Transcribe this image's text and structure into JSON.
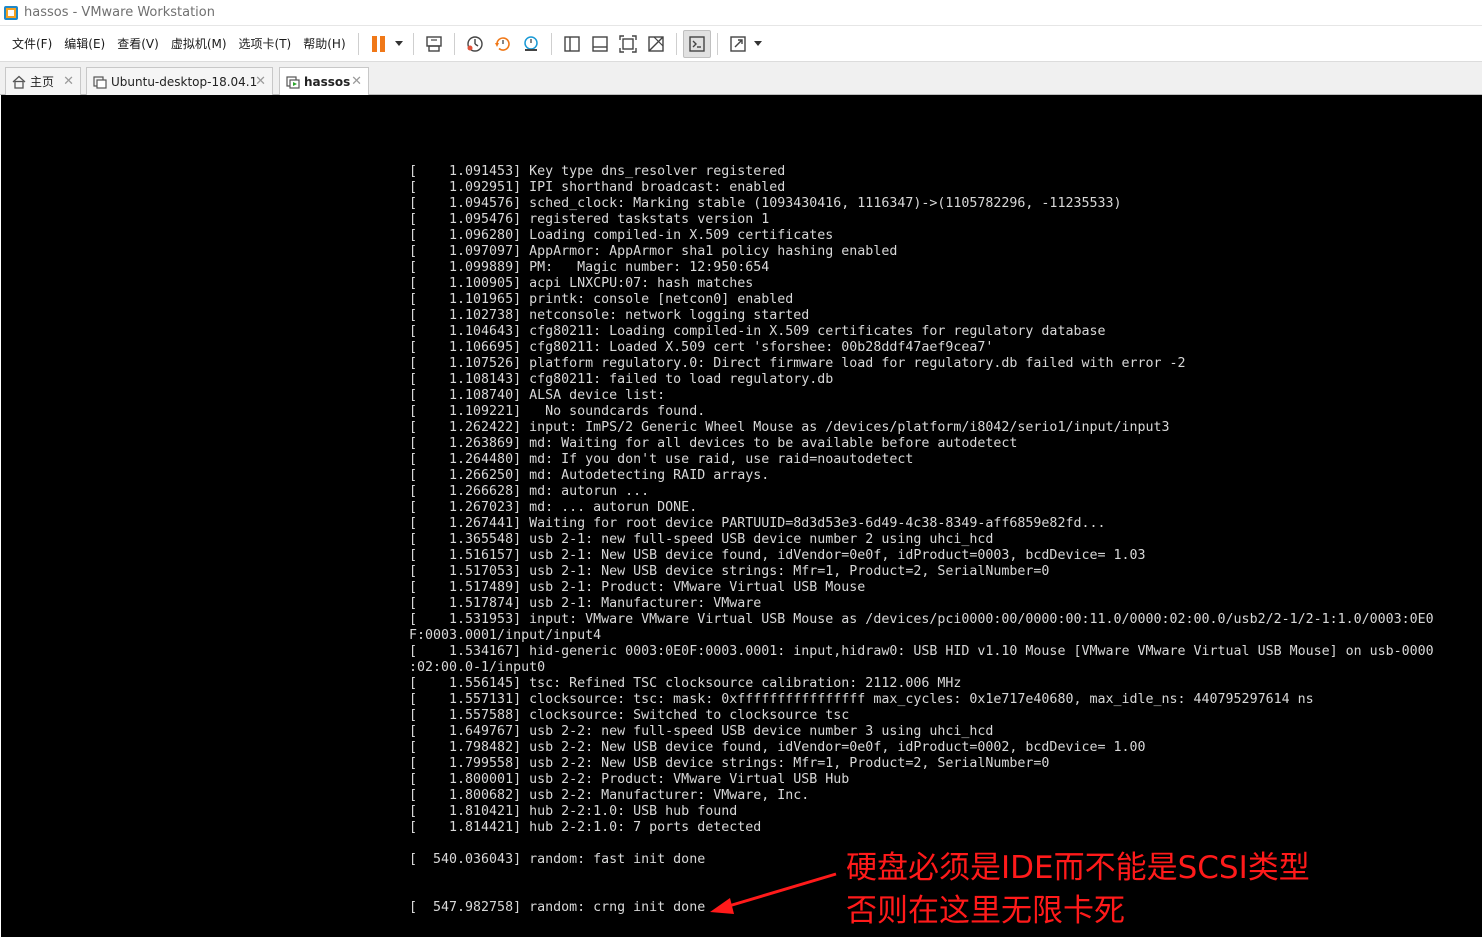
{
  "window": {
    "title": "hassos - VMware Workstation"
  },
  "menu": [
    "文件(F)",
    "编辑(E)",
    "查看(V)",
    "虚拟机(M)",
    "选项卡(T)",
    "帮助(H)"
  ],
  "toolbar": {
    "icons": [
      "pause-icon",
      "send-ctrl-alt-del-icon",
      "snapshot-icon",
      "revert-snapshot-icon",
      "snapshot-manager-icon",
      "library-view-icon",
      "thumbnail-view-icon",
      "fit-guest-icon",
      "unity-icon",
      "console-view-icon",
      "fullscreen-icon"
    ],
    "accent": "#f07818"
  },
  "tabs": [
    {
      "label": "主页",
      "icon": "home-icon",
      "selected": false
    },
    {
      "label": "Ubuntu-desktop-18.04.1",
      "icon": "vm-icon",
      "selected": false
    },
    {
      "label": "hassos",
      "icon": "vm-running-icon",
      "selected": true
    }
  ],
  "console": {
    "lines": [
      "[    1.091453] Key type dns_resolver registered",
      "[    1.092951] IPI shorthand broadcast: enabled",
      "[    1.094576] sched_clock: Marking stable (1093430416, 1116347)->(1105782296, -11235533)",
      "[    1.095476] registered taskstats version 1",
      "[    1.096280] Loading compiled-in X.509 certificates",
      "[    1.097097] AppArmor: AppArmor sha1 policy hashing enabled",
      "[    1.099889] PM:   Magic number: 12:950:654",
      "[    1.100905] acpi LNXCPU:07: hash matches",
      "[    1.101965] printk: console [netcon0] enabled",
      "[    1.102738] netconsole: network logging started",
      "[    1.104643] cfg80211: Loading compiled-in X.509 certificates for regulatory database",
      "[    1.106695] cfg80211: Loaded X.509 cert 'sforshee: 00b28ddf47aef9cea7'",
      "[    1.107526] platform regulatory.0: Direct firmware load for regulatory.db failed with error -2",
      "[    1.108143] cfg80211: failed to load regulatory.db",
      "[    1.108740] ALSA device list:",
      "[    1.109221]   No soundcards found.",
      "[    1.262422] input: ImPS/2 Generic Wheel Mouse as /devices/platform/i8042/serio1/input/input3",
      "[    1.263869] md: Waiting for all devices to be available before autodetect",
      "[    1.264480] md: If you don't use raid, use raid=noautodetect",
      "[    1.266250] md: Autodetecting RAID arrays.",
      "[    1.266628] md: autorun ...",
      "[    1.267023] md: ... autorun DONE.",
      "[    1.267441] Waiting for root device PARTUUID=8d3d53e3-6d49-4c38-8349-aff6859e82fd...",
      "[    1.365548] usb 2-1: new full-speed USB device number 2 using uhci_hcd",
      "[    1.516157] usb 2-1: New USB device found, idVendor=0e0f, idProduct=0003, bcdDevice= 1.03",
      "[    1.517053] usb 2-1: New USB device strings: Mfr=1, Product=2, SerialNumber=0",
      "[    1.517489] usb 2-1: Product: VMware Virtual USB Mouse",
      "[    1.517874] usb 2-1: Manufacturer: VMware",
      "[    1.531953] input: VMware VMware Virtual USB Mouse as /devices/pci0000:00/0000:00:11.0/0000:02:00.0/usb2/2-1/2-1:1.0/0003:0E0",
      "F:0003.0001/input/input4",
      "[    1.534167] hid-generic 0003:0E0F:0003.0001: input,hidraw0: USB HID v1.10 Mouse [VMware VMware Virtual USB Mouse] on usb-0000",
      ":02:00.0-1/input0",
      "[    1.556145] tsc: Refined TSC clocksource calibration: 2112.006 MHz",
      "[    1.557131] clocksource: tsc: mask: 0xffffffffffffffff max_cycles: 0x1e717e40680, max_idle_ns: 440795297614 ns",
      "[    1.557588] clocksource: Switched to clocksource tsc",
      "[    1.649767] usb 2-2: new full-speed USB device number 3 using uhci_hcd",
      "[    1.798482] usb 2-2: New USB device found, idVendor=0e0f, idProduct=0002, bcdDevice= 1.00",
      "[    1.799558] usb 2-2: New USB device strings: Mfr=1, Product=2, SerialNumber=0",
      "[    1.800001] usb 2-2: Product: VMware Virtual USB Hub",
      "[    1.800682] usb 2-2: Manufacturer: VMware, Inc.",
      "[    1.810421] hub 2-2:1.0: USB hub found",
      "[    1.814421] hub 2-2:1.0: 7 ports detected",
      "",
      "[  540.036043] random: fast init done",
      "",
      "",
      "[  547.982758] random: crng init done"
    ]
  },
  "annotation": {
    "line1": "硬盘必须是IDE而不能是SCSI类型",
    "line2": "否则在这里无限卡死",
    "color": "#ff1a1a"
  }
}
